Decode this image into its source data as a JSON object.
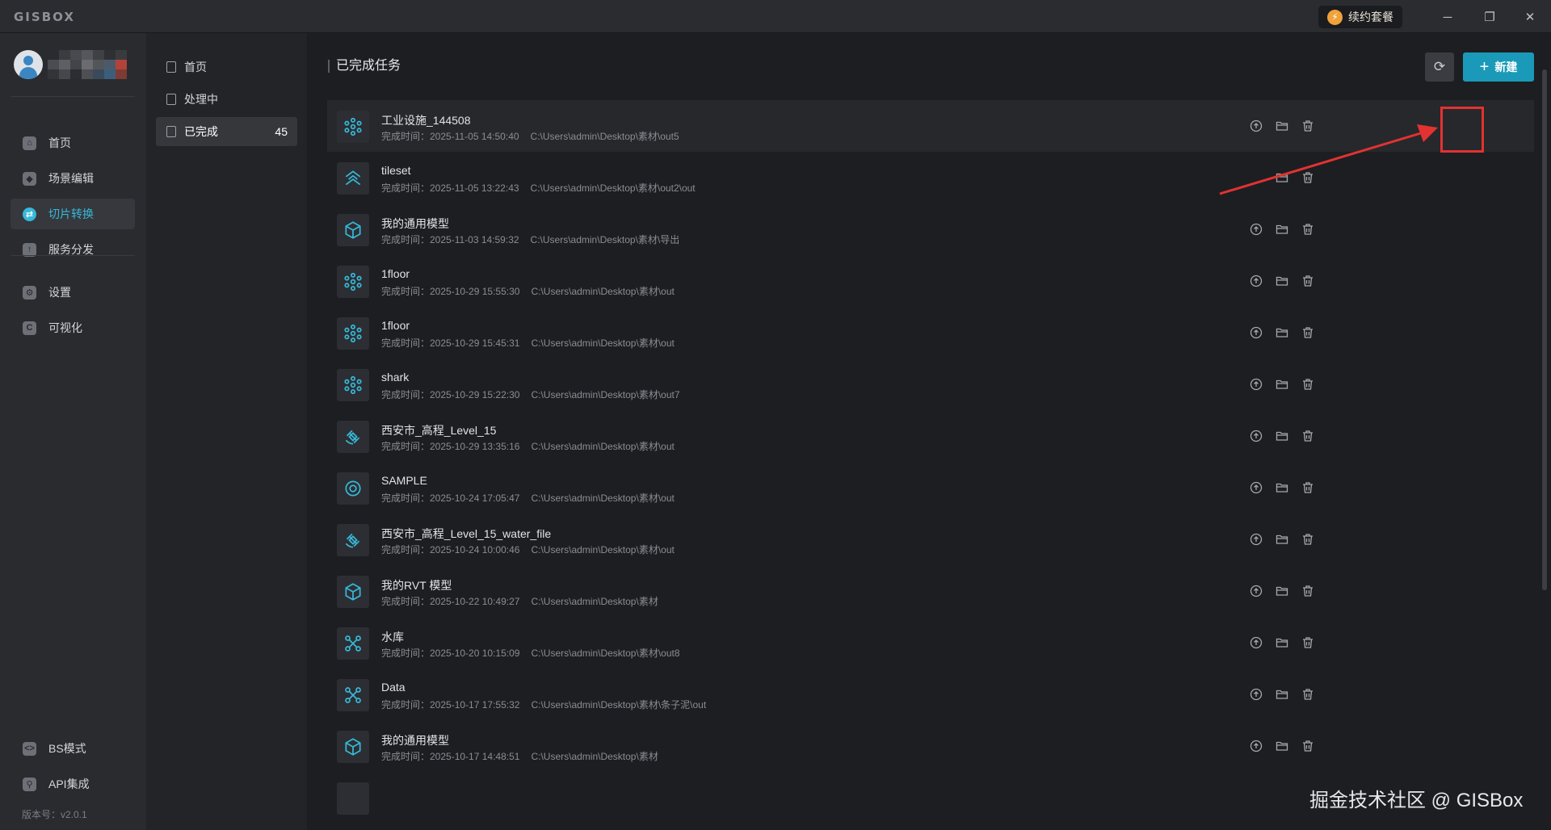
{
  "app": {
    "logo": "GISBOX",
    "renew_label": "续约套餐",
    "window_controls": [
      "minimize-icon",
      "restore-icon",
      "close-icon"
    ]
  },
  "sidebar": {
    "items": [
      {
        "label": "首页",
        "icon": "home-icon"
      },
      {
        "label": "场景编辑",
        "icon": "cube-icon"
      },
      {
        "label": "切片转换",
        "icon": "convert-icon",
        "active": true
      },
      {
        "label": "服务分发",
        "icon": "upload-icon"
      },
      {
        "label": "设置",
        "icon": "gear-icon"
      },
      {
        "label": "可视化",
        "icon": "chart-icon"
      }
    ],
    "bottom_items": [
      {
        "label": "BS模式",
        "icon": "code-icon"
      },
      {
        "label": "API集成",
        "icon": "api-icon"
      }
    ],
    "version": "版本号：v2.0.1"
  },
  "subnav": {
    "items": [
      {
        "label": "首页"
      },
      {
        "label": "处理中"
      },
      {
        "label": "已完成",
        "count": "45",
        "active": true
      }
    ]
  },
  "main": {
    "title": "已完成任务",
    "new_label": "新建",
    "tasks": [
      {
        "name": "工业设施_144508",
        "time": "完成时间：2025-11-05 14:50:40",
        "path": "C:\\Users\\admin\\Desktop\\素材\\out5",
        "icon": "point-cloud-icon",
        "publish": true
      },
      {
        "name": "tileset",
        "time": "完成时间：2025-11-05 13:22:43",
        "path": "C:\\Users\\admin\\Desktop\\素材\\out2\\out",
        "icon": "tileset-icon",
        "publish": false
      },
      {
        "name": "我的通用模型",
        "time": "完成时间：2025-11-03 14:59:32",
        "path": "C:\\Users\\admin\\Desktop\\素材\\导出",
        "icon": "cube-model-icon",
        "publish": true
      },
      {
        "name": "1floor",
        "time": "完成时间：2025-10-29 15:55:30",
        "path": "C:\\Users\\admin\\Desktop\\素材\\out",
        "icon": "point-cloud-icon",
        "publish": true
      },
      {
        "name": "1floor",
        "time": "完成时间：2025-10-29 15:45:31",
        "path": "C:\\Users\\admin\\Desktop\\素材\\out",
        "icon": "point-cloud-icon",
        "publish": true
      },
      {
        "name": "shark",
        "time": "完成时间：2025-10-29 15:22:30",
        "path": "C:\\Users\\admin\\Desktop\\素材\\out7",
        "icon": "point-cloud-icon",
        "publish": true
      },
      {
        "name": "西安市_高程_Level_15",
        "time": "完成时间：2025-10-29 13:35:16",
        "path": "C:\\Users\\admin\\Desktop\\素材\\out",
        "icon": "satellite-icon",
        "publish": true
      },
      {
        "name": "SAMPLE",
        "time": "完成时间：2025-10-24 17:05:47",
        "path": "C:\\Users\\admin\\Desktop\\素材\\out",
        "icon": "target-icon",
        "publish": true
      },
      {
        "name": "西安市_高程_Level_15_water_file",
        "time": "完成时间：2025-10-24 10:00:46",
        "path": "C:\\Users\\admin\\Desktop\\素材\\out",
        "icon": "satellite-icon",
        "publish": true
      },
      {
        "name": "我的RVT 模型",
        "time": "完成时间：2025-10-22 10:49:27",
        "path": "C:\\Users\\admin\\Desktop\\素材",
        "icon": "cube-model-icon",
        "publish": true
      },
      {
        "name": "水库",
        "time": "完成时间：2025-10-20 10:15:09",
        "path": "C:\\Users\\admin\\Desktop\\素材\\out8",
        "icon": "network-icon",
        "publish": true
      },
      {
        "name": "Data",
        "time": "完成时间：2025-10-17 17:55:32",
        "path": "C:\\Users\\admin\\Desktop\\素材\\条子泥\\out",
        "icon": "network-icon",
        "publish": true
      },
      {
        "name": "我的通用模型",
        "time": "完成时间：2025-10-17 14:48:51",
        "path": "C:\\Users\\admin\\Desktop\\素材",
        "icon": "cube-model-icon",
        "publish": true
      }
    ]
  },
  "watermark": "掘金技术社区 @ GISBox",
  "colors": {
    "accent": "#1a9ab8",
    "icon_cyan": "#36b9d8",
    "annotation_red": "#e23232"
  }
}
